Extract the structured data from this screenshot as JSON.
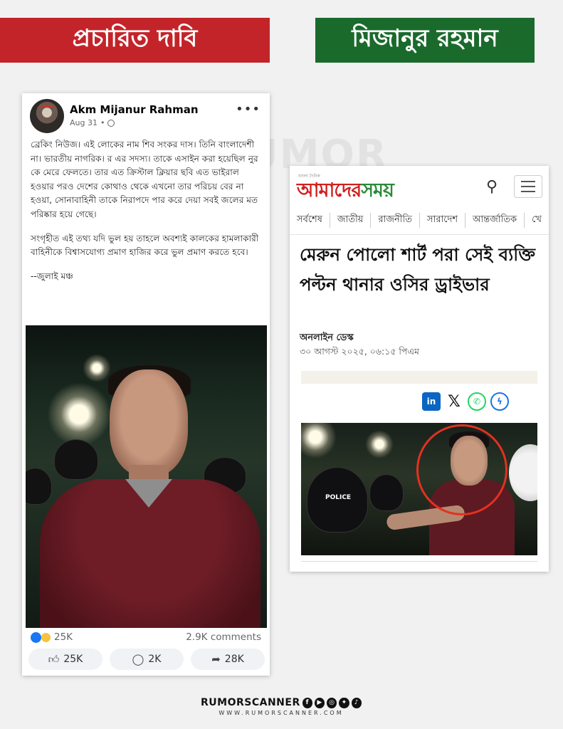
{
  "banners": {
    "left": "প্রচারিত দাবি",
    "right": "মিজানুর রহমান"
  },
  "watermark": "RUMOR",
  "fb_post": {
    "author": "Akm Mijanur Rahman",
    "date": "Aug 31",
    "separator": "•",
    "more": "•••",
    "paragraphs": [
      "ব্রেকিং নিউজ। এই লোকের নাম শিব সংকর দাস। তিনি বাংলাদেশী না। ভারতীয় নাগরিক। র এর সদস্য।  তাকে এসাইন করা হয়েছিল নুর কে মেরে ফেলতে। তার এত ক্রিস্টাল ক্লিয়ার ছবি এত ভাইরাল হওয়ার পরও দেশের কোথাও থেকে এখনো তার পরিচয় বের না হওয়া, সোনাবাহিনী তাকে নিরাপদে পার করে দেয়া সবই জলের মত পরিষ্কার হয়ে গেছে।",
      "সংগৃহীত এই তথ্য যদি ভুল হয় তাহলে অবশ্যই কালকের হামলাকারী বাহিনীকে বিশ্বাসযোগ্য প্রমাণ হাজির করে ভুল প্রমাণ করতে হবে।",
      "--জুলাই মঞ্চ"
    ],
    "reactions_count": "25K",
    "comments_count": "2.9K comments",
    "actions": {
      "like": "25K",
      "comment": "2K",
      "share": "28K"
    }
  },
  "news": {
    "logo_tag": "বাংলা দৈনিক",
    "logo_part1": "আমাদের",
    "logo_part2": "সময়",
    "nav": [
      "সর্বশেষ",
      "জাতীয়",
      "রাজনীতি",
      "সারাদেশ",
      "আন্তর্জাতিক",
      "খে"
    ],
    "headline": "মেরুন পোলো শার্ট পরা সেই ব্যক্তি পল্টন থানার ওসির ড্রাইভার",
    "author": "অনলাইন ডেস্ক",
    "date": "৩০ আগস্ট ২০২৫, ০৬:১৫ পিএম",
    "photo_text": "POLICE"
  },
  "footer": {
    "brand": "RUMORSCANNER",
    "url": "WWW.RUMORSCANNER.COM"
  },
  "colors": {
    "banner_red": "#c3242a",
    "banner_green": "#1a6a2c",
    "fb_blue": "#1877f2",
    "highlight_circle": "#e3311f"
  }
}
